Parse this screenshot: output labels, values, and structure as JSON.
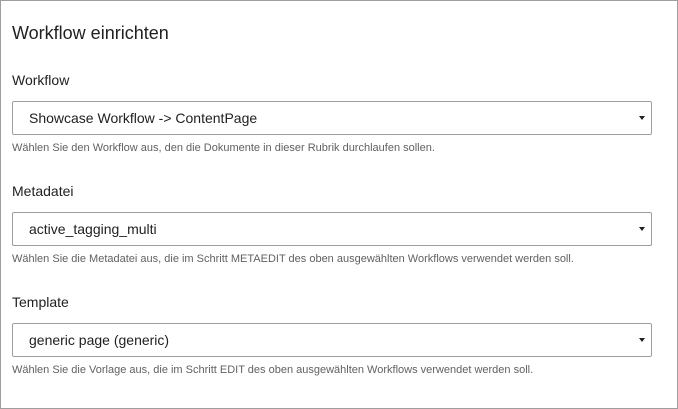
{
  "title": "Workflow einrichten",
  "fields": [
    {
      "label": "Workflow",
      "value": "Showcase Workflow -> ContentPage",
      "help": "Wählen Sie den Workflow aus, den die Dokumente in dieser Rubrik durchlaufen sollen."
    },
    {
      "label": "Metadatei",
      "value": "active_tagging_multi",
      "help": "Wählen Sie die Metadatei aus, die im Schritt METAEDIT des oben ausgewählten Workflows verwendet werden soll."
    },
    {
      "label": "Template",
      "value": "generic page (generic)",
      "help": "Wählen Sie die Vorlage aus, die im Schritt EDIT des oben ausgewählten Workflows verwendet werden soll."
    }
  ],
  "colors": {
    "border": "#9e9e9e",
    "text": "#212121",
    "help_text": "#616161"
  },
  "icons": {
    "dropdown": "caret-down-icon"
  }
}
